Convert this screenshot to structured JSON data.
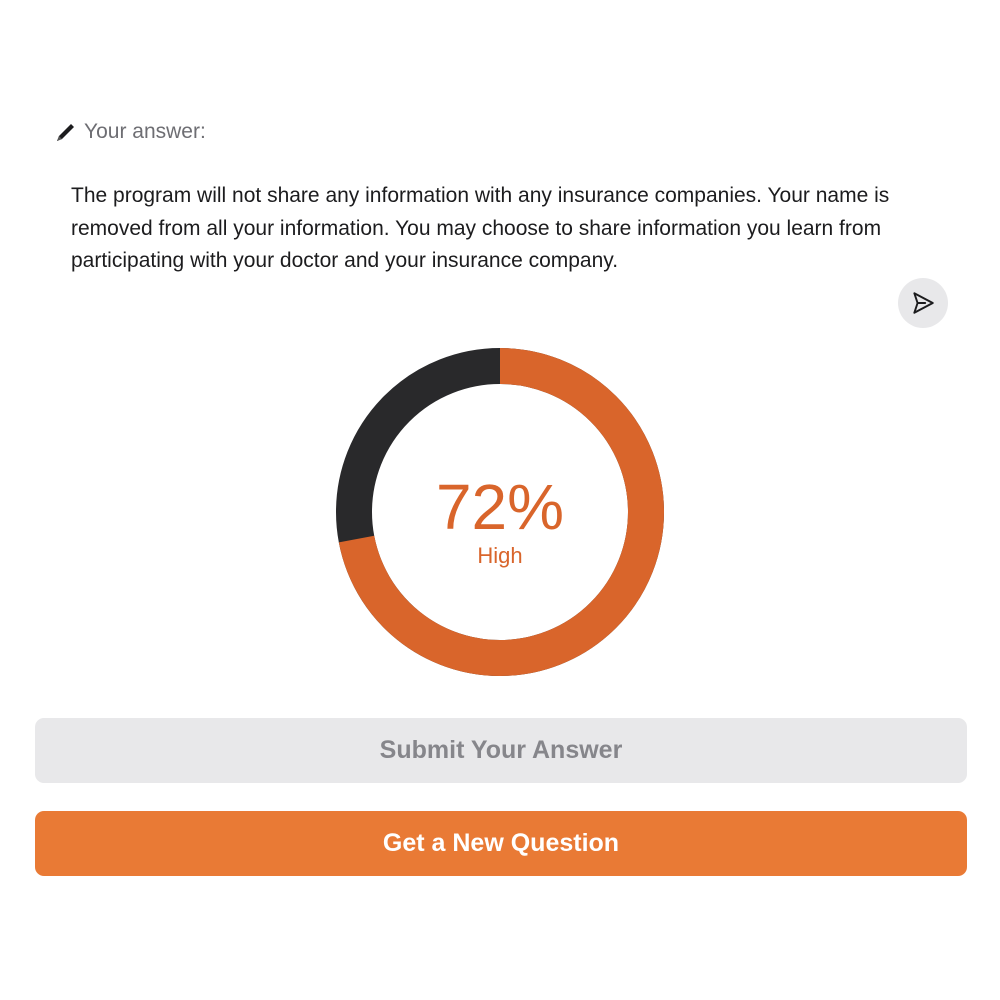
{
  "answer": {
    "label": "Your answer:",
    "label_icon": "pen-icon",
    "text": "The program will not share any information with any insurance companies. Your name is removed from all your information. You may choose to share information you learn from participating with your doctor and your insurance company.",
    "send_icon": "send-icon"
  },
  "score": {
    "percent_text": "72%",
    "percent_value": 72,
    "level": "High",
    "fill_color": "#d9652b",
    "remainder_color": "#29292b"
  },
  "buttons": {
    "submit_label": "Submit Your Answer",
    "new_question_label": "Get a New Question"
  },
  "colors": {
    "accent": "#e97a35",
    "disabled_bg": "#e8e8ea",
    "disabled_text": "#86868b"
  }
}
